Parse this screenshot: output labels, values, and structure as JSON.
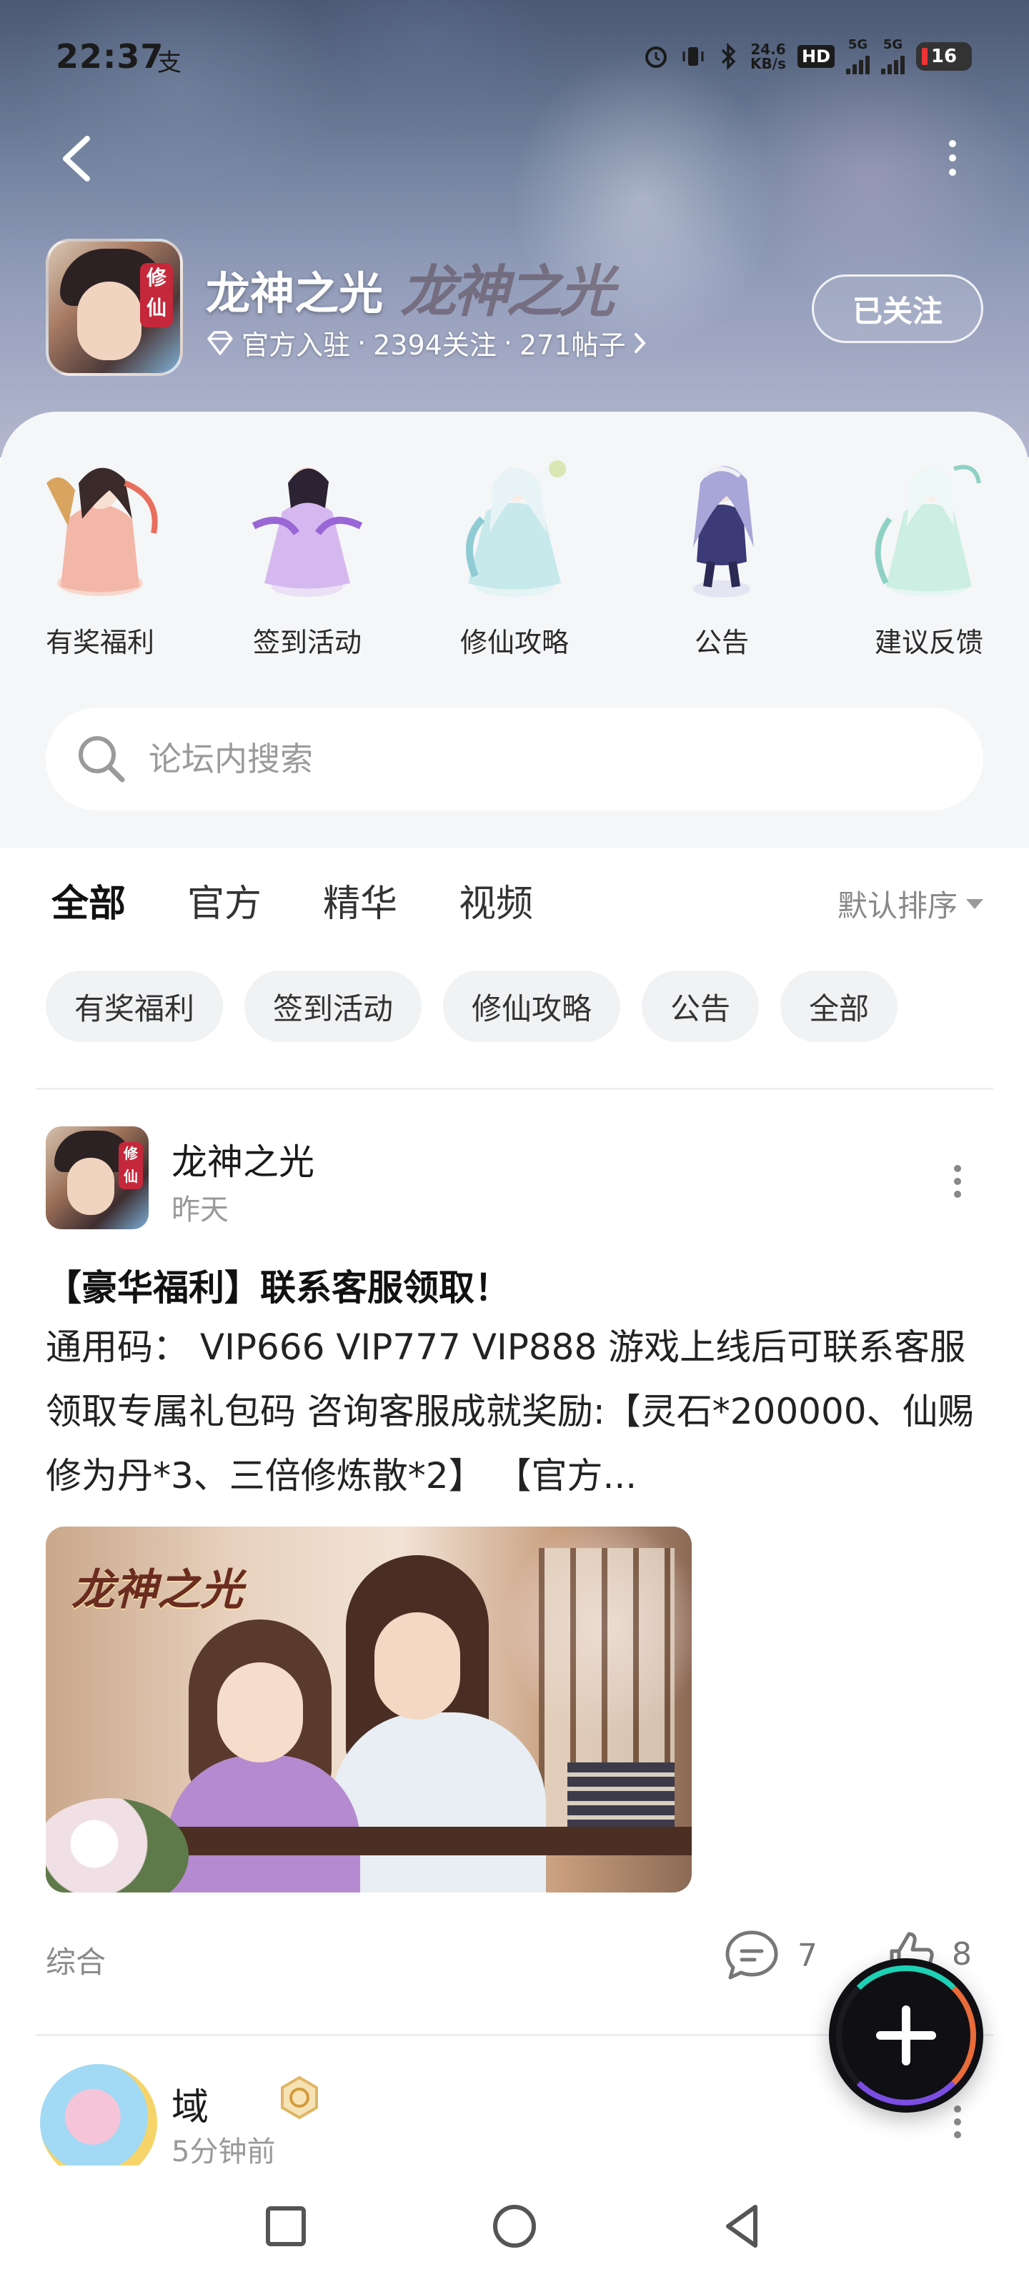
{
  "status_bar": {
    "time": "22:37",
    "pay_icon": "支",
    "net_speed_top": "24.6",
    "net_speed_bottom": "KB/s",
    "hd_label": "HD",
    "sim1": "5G",
    "sim2": "5G",
    "battery": "16",
    "icons": [
      "alarm-icon",
      "vibrate-icon",
      "bluetooth-icon",
      "hd-voice-icon",
      "signal-icon",
      "signal-icon",
      "battery-icon"
    ]
  },
  "header": {
    "forum_name": "龙神之光",
    "forum_name_art": "龙神之光",
    "meta_official": "官方入驻",
    "meta_sep": "·",
    "meta_follows": "2394关注",
    "meta_posts": "271帖子",
    "follow_label": "已关注",
    "logo_seal": "修仙"
  },
  "entries": [
    {
      "label": "有奖福利",
      "colors": [
        "#f3b7a8",
        "#e86e5e",
        "#3b2a2a"
      ]
    },
    {
      "label": "签到活动",
      "colors": [
        "#d6b8f0",
        "#9a66d6",
        "#2b2233"
      ]
    },
    {
      "label": "修仙攻略",
      "colors": [
        "#c7e9ec",
        "#8fcbd4",
        "#e8f3f6"
      ]
    },
    {
      "label": "公告",
      "colors": [
        "#a8a6d8",
        "#3d3a78",
        "#f0f0f6"
      ]
    },
    {
      "label": "建议反馈",
      "colors": [
        "#cdeee3",
        "#8fd1c4",
        "#eef8f6"
      ]
    }
  ],
  "search": {
    "placeholder": "论坛内搜索"
  },
  "tabs": [
    {
      "label": "全部",
      "active": true
    },
    {
      "label": "官方",
      "active": false
    },
    {
      "label": "精华",
      "active": false
    },
    {
      "label": "视频",
      "active": false
    }
  ],
  "sort_label": "默认排序",
  "chips": [
    "有奖福利",
    "签到活动",
    "修仙攻略",
    "公告",
    "全部"
  ],
  "post1": {
    "author": "龙神之光",
    "time": "昨天",
    "avatar_seal": "修仙",
    "title": "【豪华福利】联系客服领取！",
    "body": "通用码： VIP666 VIP777 VIP888 游戏上线后可联系客服领取专属礼包码 咨询客服成就奖励:【灵石*200000、仙赐修为丹*3、三倍修炼散*2】 【官方...",
    "image_title": "龙神之光",
    "tag": "综合",
    "comments": "7",
    "likes": "8"
  },
  "post2": {
    "author": "域",
    "time": "5分钟前"
  },
  "colors": {
    "accent": "#2ad7bd",
    "chip_bg": "#f1f2f4",
    "panel_bg": "#f5f6f8"
  }
}
